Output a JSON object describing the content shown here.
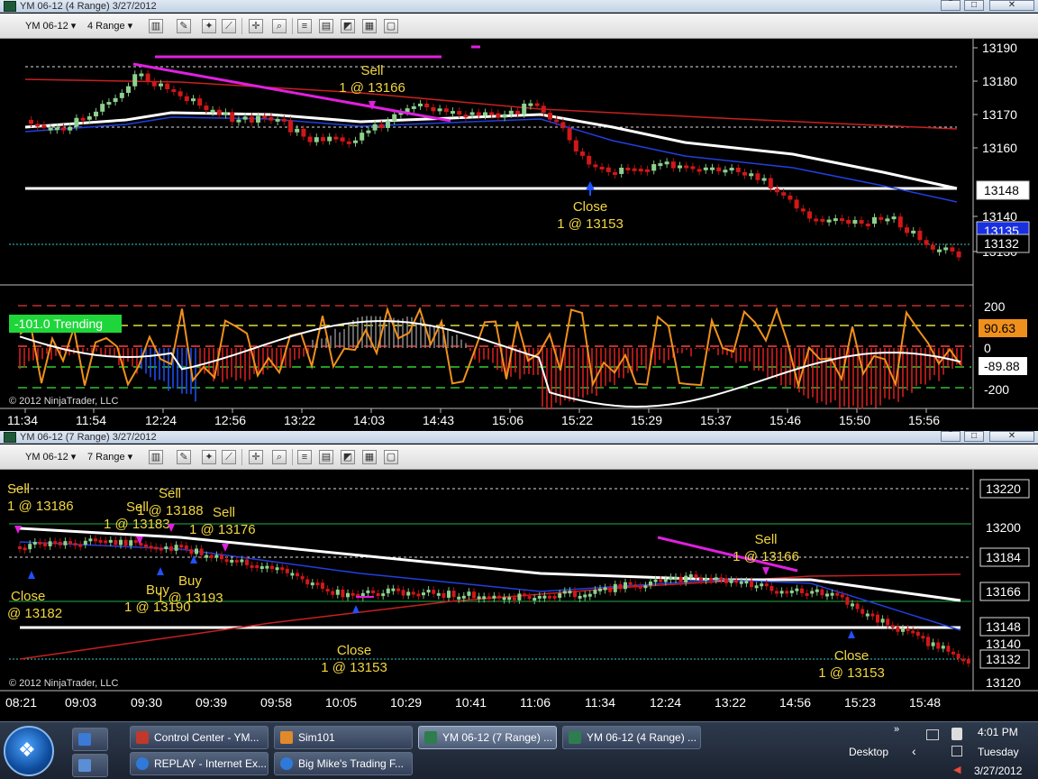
{
  "top_window": {
    "title": "YM 06-12 (4 Range)  3/27/2012",
    "toolbar": {
      "instrument": "YM 06-12",
      "period": "4 Range"
    },
    "price_axis_labels": [
      "13190",
      "13180",
      "13170",
      "13160",
      "13140",
      "13130"
    ],
    "price_markers": {
      "line_white": "13148",
      "ask": "13135",
      "last": "13132"
    },
    "indicator_axis_labels": [
      "200",
      "0",
      "-200"
    ],
    "indicator_markers": {
      "orange": "90.63",
      "white": "-89.88"
    },
    "trend_label": "-101.0 Trending",
    "copyright": "© 2012 NinjaTrader, LLC",
    "time_labels": [
      "11:34",
      "11:54",
      "12:24",
      "12:56",
      "13:22",
      "14:03",
      "14:43",
      "15:06",
      "15:22",
      "15:29",
      "15:37",
      "15:46",
      "15:50",
      "15:56"
    ],
    "annotations": [
      {
        "line1": "Sell",
        "line2": "1 @ 13166"
      },
      {
        "line1": "Close",
        "line2": "1 @ 13153"
      }
    ]
  },
  "bottom_window": {
    "title": "YM 06-12 (7 Range)  3/27/2012",
    "toolbar": {
      "instrument": "YM 06-12",
      "period": "7 Range"
    },
    "price_axis_labels": [
      "13200",
      "13140",
      "13120"
    ],
    "price_markers": {
      "top": "13220",
      "m1": "13184",
      "m2": "13166",
      "m3": "13148",
      "m4": "13132"
    },
    "copyright": "© 2012 NinjaTrader, LLC",
    "time_labels": [
      "08:21",
      "09:03",
      "09:30",
      "09:39",
      "09:58",
      "10:05",
      "10:29",
      "10:41",
      "11:06",
      "11:34",
      "12:24",
      "13:22",
      "14:56",
      "15:23",
      "15:48"
    ],
    "annotations": [
      {
        "line1": "Sell",
        "line2": "1 @ 13186"
      },
      {
        "line1": "Sell",
        "line2": "1 @ 13183"
      },
      {
        "line1": "Sell",
        "line2": "1 @ 13188"
      },
      {
        "line1": "Sell",
        "line2": "1 @ 13176"
      },
      {
        "line1": "Close",
        "line2": "@ 13182"
      },
      {
        "line1": "Buy",
        "line2": "1 @ 13190"
      },
      {
        "line1": "Buy",
        "line2": "1 @ 13193"
      },
      {
        "line1": "Close",
        "line2": "1 @ 13153"
      },
      {
        "line1": "Sell",
        "line2": "1 @ 13166"
      },
      {
        "line1": "Close",
        "line2": "1 @ 13153"
      }
    ]
  },
  "taskbar": {
    "buttons": [
      "Control Center - YM...",
      "Sim101",
      "YM 06-12 (7 Range) ...",
      "YM 06-12 (4 Range) ...",
      "REPLAY - Internet Ex...",
      "Big Mike's Trading F..."
    ],
    "desktop_label": "Desktop",
    "clock_time": "4:01 PM",
    "clock_day": "Tuesday",
    "clock_date": "3/27/2012"
  },
  "colors": {
    "up_candle": "#8ed18e",
    "down_candle": "#d01818",
    "sell_text": "#f2d640",
    "trend_line": "#e020e0"
  }
}
